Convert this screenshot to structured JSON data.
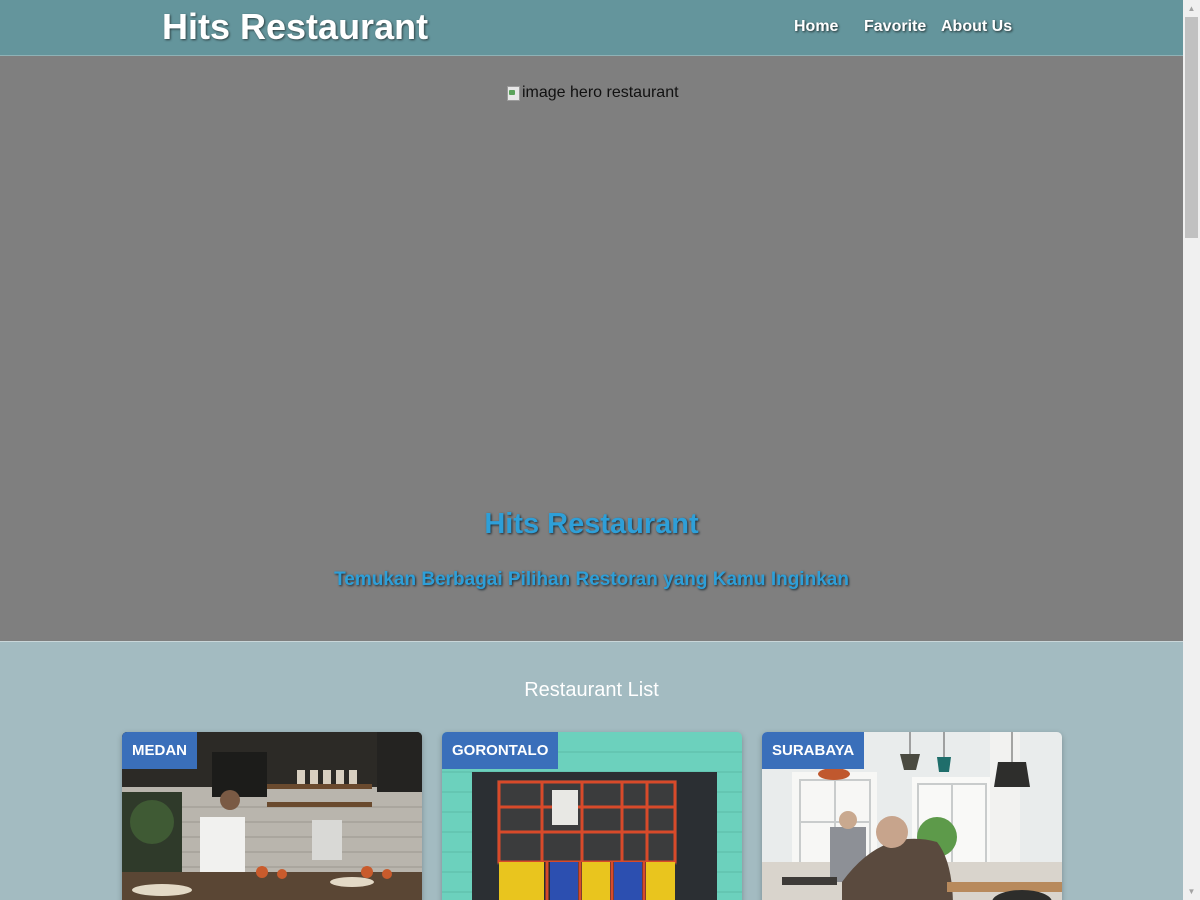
{
  "header": {
    "brand": "Hits Restaurant",
    "nav": [
      {
        "label": "Home"
      },
      {
        "label": "Favorite"
      },
      {
        "label": "About Us"
      }
    ]
  },
  "hero": {
    "image_alt": "image hero restaurant",
    "title": "Hits Restaurant",
    "tagline": "Temukan Berbagai Pilihan Restoran yang Kamu Inginkan"
  },
  "restaurant_list": {
    "heading": "Restaurant List",
    "cards": [
      {
        "city": "MEDAN"
      },
      {
        "city": "GORONTALO"
      },
      {
        "city": "SURABAYA"
      }
    ]
  },
  "colors": {
    "header_bg": "#64959c",
    "hero_bg": "#7f7f7f",
    "hero_text": "#2e9fd8",
    "content_bg": "#a3bbc1",
    "badge_bg": "#3a6fba"
  },
  "icons": {
    "hero_image": "broken-image-icon",
    "scroll_up": "triangle-up-icon",
    "scroll_down": "triangle-down-icon"
  }
}
